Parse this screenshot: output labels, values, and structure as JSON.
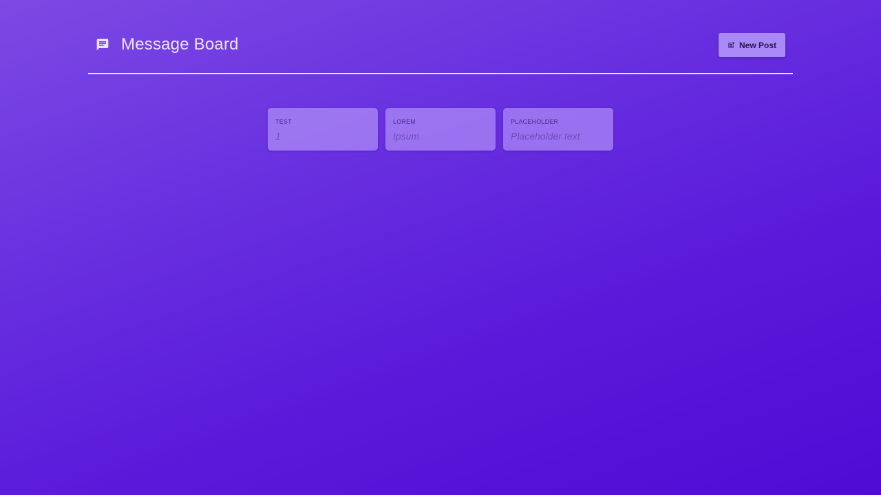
{
  "header": {
    "title": "Message Board",
    "icon": "message-icon",
    "new_post_label": "New Post",
    "new_post_icon": "post-add-icon"
  },
  "posts": [
    {
      "title": "Test",
      "body": "1"
    },
    {
      "title": "Lorem",
      "body": "Ipsum"
    },
    {
      "title": "Placeholder",
      "body": "Placeholder text"
    }
  ],
  "colors": {
    "background_start": "#7d49e3",
    "background_end": "#4f0bd4",
    "button": "#a989f5",
    "title_text": "#ece4ff"
  }
}
